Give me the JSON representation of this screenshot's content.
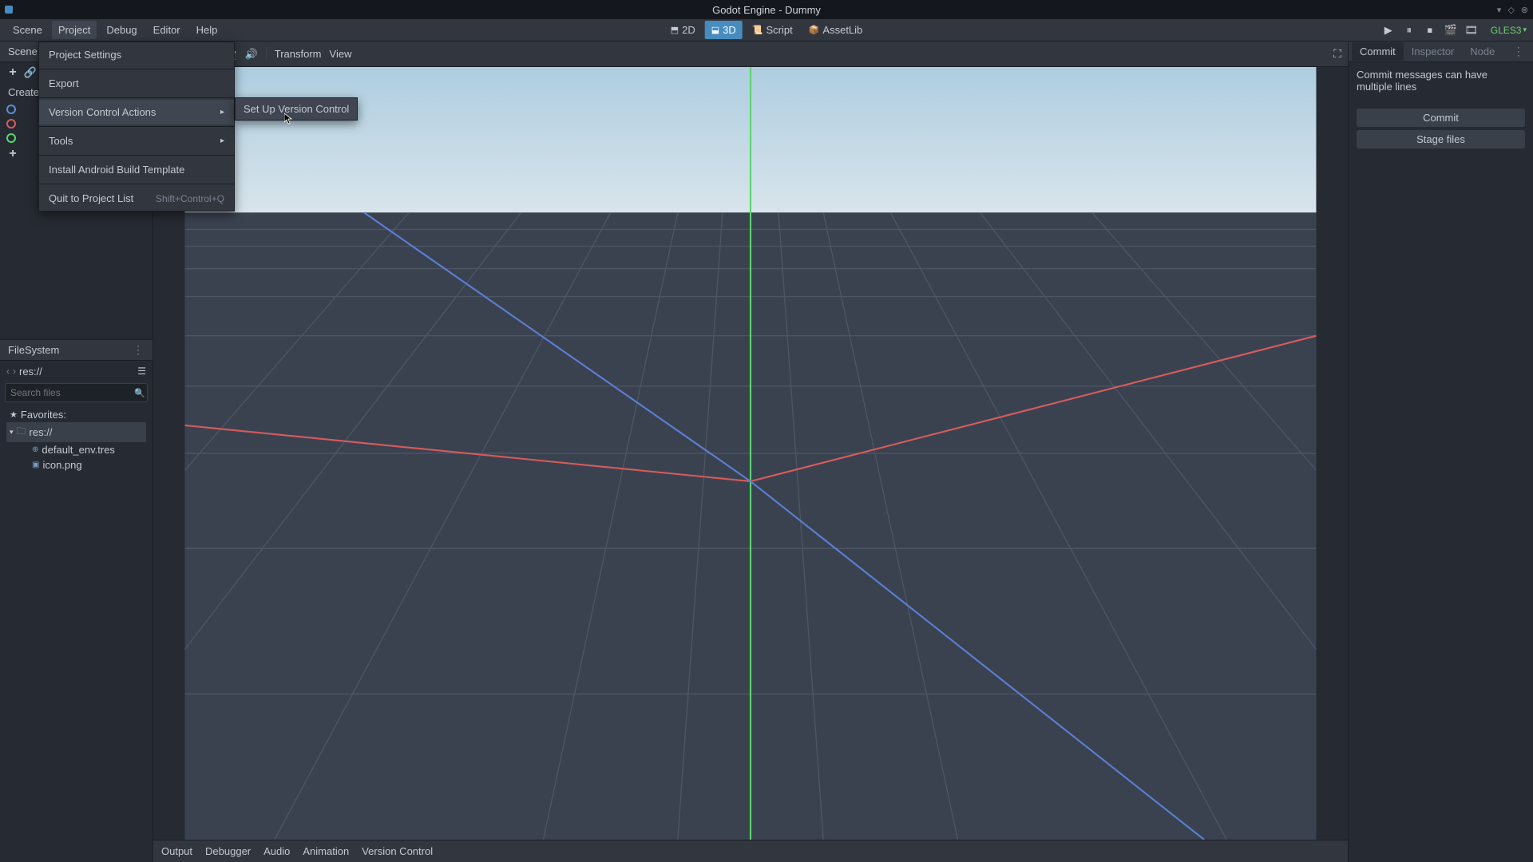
{
  "titlebar": {
    "title": "Godot Engine - Dummy"
  },
  "menubar": {
    "items": [
      "Scene",
      "Project",
      "Debug",
      "Editor",
      "Help"
    ],
    "modes": {
      "d2": "2D",
      "d3": "3D",
      "script": "Script",
      "assetlib": "AssetLib"
    },
    "gles": "GLES3"
  },
  "scene_dock": {
    "tab": "Scene",
    "create_label": "Create"
  },
  "filesystem": {
    "tab": "FileSystem",
    "path": "res://",
    "search_placeholder": "Search files",
    "favorites": "Favorites:",
    "root": "res://",
    "files": [
      "default_env.tres",
      "icon.png"
    ]
  },
  "viewport_toolbar": {
    "transform": "Transform",
    "view": "View"
  },
  "bottom_tabs": [
    "Output",
    "Debugger",
    "Audio",
    "Animation",
    "Version Control"
  ],
  "right_dock": {
    "tabs": [
      "Commit",
      "Inspector",
      "Node"
    ],
    "commit_msg": "Commit messages can have multiple lines",
    "commit_btn": "Commit",
    "stage_btn": "Stage files"
  },
  "dropdown": {
    "project_settings": "Project Settings",
    "export": "Export",
    "version_control": "Version Control Actions",
    "tools": "Tools",
    "install_android": "Install Android Build Template",
    "quit": "Quit to Project List",
    "quit_shortcut": "Shift+Control+Q"
  },
  "submenu": {
    "setup_vc": "Set Up Version Control"
  }
}
